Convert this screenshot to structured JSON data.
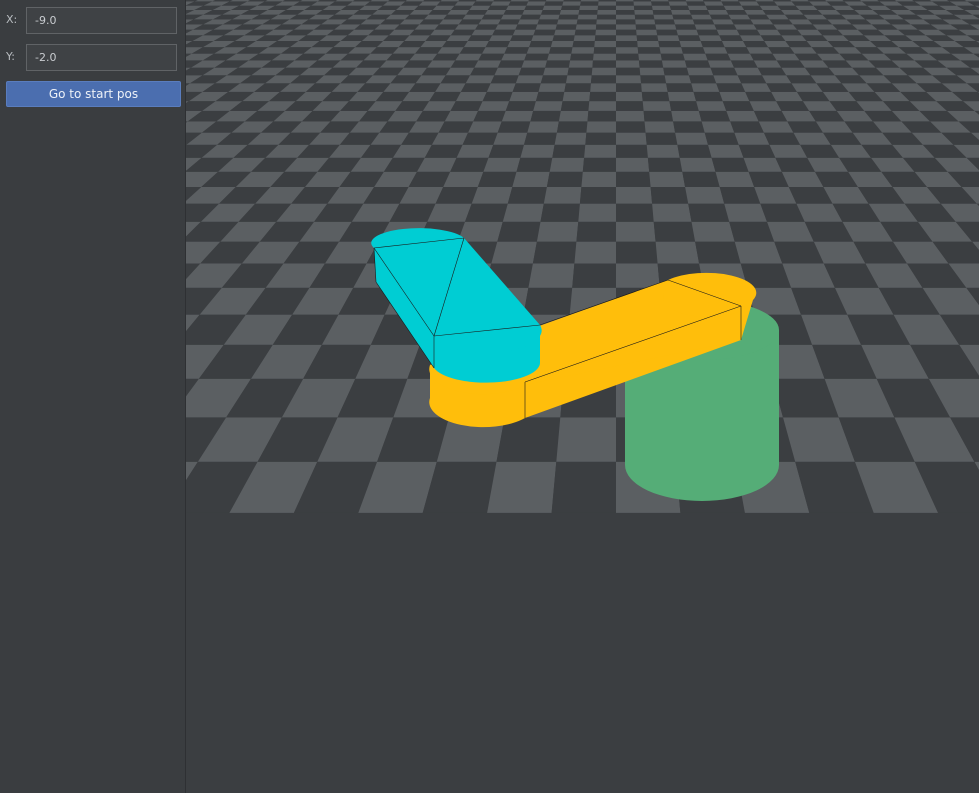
{
  "controls": {
    "x": {
      "label": "X:",
      "value": "-9.0"
    },
    "y": {
      "label": "Y:",
      "value": "-2.0"
    },
    "start_button_label": "Go to start pos"
  },
  "scene": {
    "floor_colors": {
      "light": "#5b5f62",
      "dark": "#3b3e41"
    },
    "base_color": "#55ad77",
    "arm1_color": "#ffbe0b",
    "arm2_color": "#00cdd3"
  }
}
